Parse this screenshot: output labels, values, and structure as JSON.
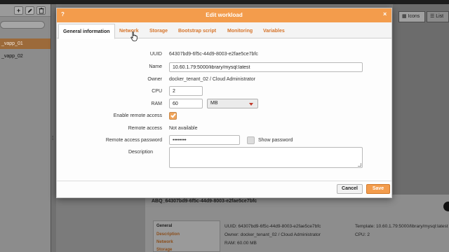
{
  "app": {
    "left_toolbar": {
      "add_label": "+",
      "edit_label": "✎",
      "delete_label": "🗑"
    },
    "vapps": [
      {
        "label": "_vapp_01",
        "selected": true
      },
      {
        "label": "_vapp_02",
        "selected": false
      }
    ],
    "view_tabs": [
      {
        "label": "Icons",
        "icon": "grid-icon"
      },
      {
        "label": "List",
        "icon": "list-icon"
      }
    ],
    "details": {
      "title": "ABQ_64307bd9-6f5c-44d9-8003-e2fae5ce7bfc",
      "nav": [
        "General",
        "Description",
        "Network",
        "Storage"
      ],
      "uuid_line": "UUID: 64307bd9-6f5c-44d9-8003-e2fae5ce7bfc",
      "owner_line": "Owner: docker_tenant_02 / Cloud Administrator",
      "ram_line": "RAM: 60.00 MB",
      "template_line": "Template: 10.60.1.79:5000/library/mysql:latest",
      "cpu_line": "CPU: 2"
    }
  },
  "dialog": {
    "title": "Edit workload",
    "help_label": "?",
    "close_label": "×",
    "tabs": [
      {
        "label": "General information",
        "active": true
      },
      {
        "label": "Network",
        "active": false
      },
      {
        "label": "Storage",
        "active": false
      },
      {
        "label": "Bootstrap script",
        "active": false
      },
      {
        "label": "Monitoring",
        "active": false
      },
      {
        "label": "Variables",
        "active": false
      }
    ],
    "form": {
      "uuid_label": "UUID",
      "uuid_value": "64307bd9-6f5c-44d9-8003-e2fae5ce7bfc",
      "name_label": "Name",
      "name_value": "10.60.1.79:5000/library/mysql:latest",
      "owner_label": "Owner",
      "owner_value": "docker_tenant_02 / Cloud Administrator",
      "cpu_label": "CPU",
      "cpu_value": "2",
      "ram_label": "RAM",
      "ram_value": "60",
      "ram_unit": "MB",
      "remote_access_enable_label": "Enable remote access",
      "remote_access_enabled": true,
      "remote_access_label": "Remote access",
      "remote_access_value": "Not available",
      "password_label": "Remote access password",
      "password_value": "••••••••",
      "show_password_label": "Show password",
      "show_password_checked": false,
      "description_label": "Description",
      "description_value": ""
    },
    "buttons": {
      "cancel": "Cancel",
      "save": "Save"
    }
  },
  "colors": {
    "accent": "#f39c4c",
    "tab_link": "#d6742a",
    "selected_item": "#9c6a3a"
  }
}
